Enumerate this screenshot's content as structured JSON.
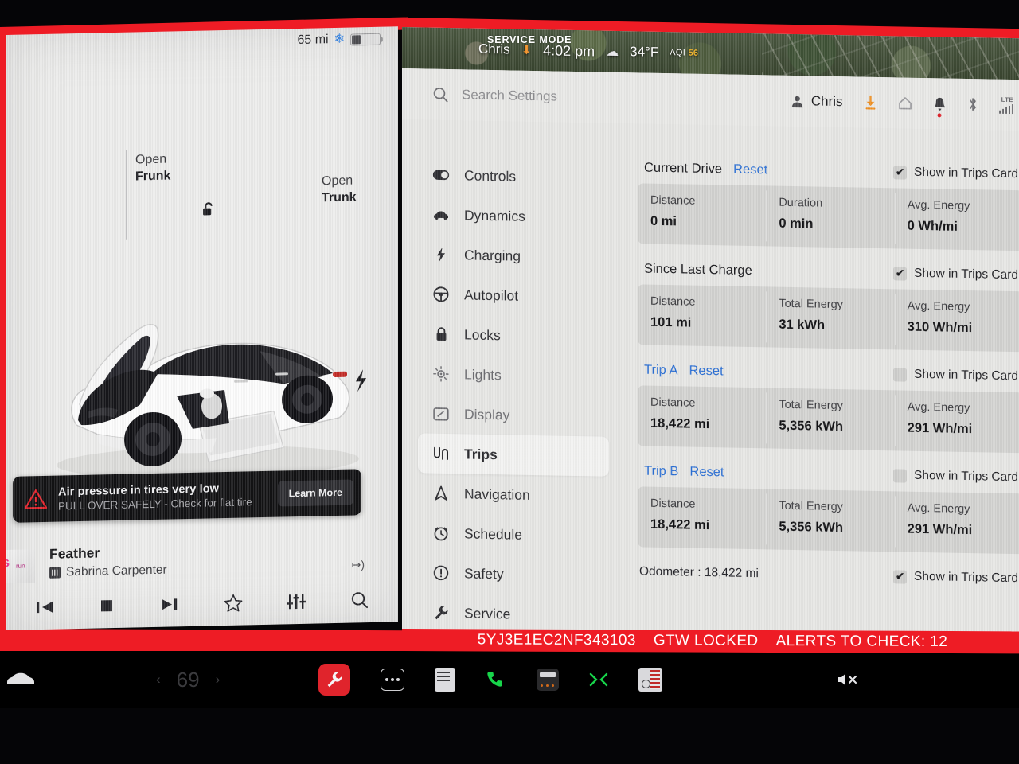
{
  "service_mode": {
    "label": "SERVICE MODE",
    "accent_color": "#ee1c25"
  },
  "bottom_status": {
    "vin": "5YJ3E1EC2NF343103",
    "gateway": "GTW LOCKED",
    "alerts": "ALERTS TO CHECK: 12"
  },
  "left_panel": {
    "range": "65 mi",
    "snowflake_icon": "snowflake-icon",
    "battery_icon": "battery-icon",
    "frunk": {
      "action": "Open",
      "target": "Frunk"
    },
    "trunk": {
      "action": "Open",
      "target": "Trunk"
    },
    "lock_icon": "unlocked-padlock-icon",
    "car_icon": "tesla-model-3-icon",
    "alert": {
      "icon": "warning-triangle-icon",
      "title": "Air pressure in tires very low",
      "subtitle": "PULL OVER SAFELY - Check for flat tire",
      "button": "Learn More"
    },
    "media": {
      "title": "Feather",
      "artist": "Sabrina Carpenter",
      "source_icon": "source-badge-icon",
      "hd_icon": "hd-audio-icon",
      "controls": [
        {
          "name": "previous-track-button",
          "glyph": "❘◀"
        },
        {
          "name": "stop-button",
          "glyph": "■"
        },
        {
          "name": "next-track-button",
          "glyph": "▶❘"
        },
        {
          "name": "favorite-button",
          "glyph": "☆"
        },
        {
          "name": "equalizer-button",
          "glyph": "⦀"
        },
        {
          "name": "media-search-button",
          "glyph": "⌕"
        }
      ]
    }
  },
  "map_bar": {
    "user": "Chris",
    "download_icon": "download-icon",
    "time": "4:02 pm",
    "weather_icon": "cloud-icon",
    "temperature": "34°F",
    "aqi_label": "AQI",
    "aqi_value": "56"
  },
  "settings_top": {
    "search_icon": "search-icon",
    "search_placeholder": "Search Settings",
    "search_value": "",
    "user": "Chris",
    "user_icon": "person-icon",
    "icons": [
      {
        "name": "download-icon",
        "glyph": "⬇"
      },
      {
        "name": "home-icon",
        "glyph": "⌂"
      },
      {
        "name": "bell-icon",
        "glyph": "🔔"
      },
      {
        "name": "bluetooth-icon",
        "glyph": "ᛗ"
      }
    ],
    "network_label": "LTE"
  },
  "sidebar": {
    "items": [
      {
        "label": "Controls",
        "icon": "toggle-icon",
        "selected": false,
        "faded": false
      },
      {
        "label": "Dynamics",
        "icon": "car-icon",
        "selected": false,
        "faded": false
      },
      {
        "label": "Charging",
        "icon": "lightning-bolt-icon",
        "selected": false,
        "faded": false
      },
      {
        "label": "Autopilot",
        "icon": "steering-wheel-icon",
        "selected": false,
        "faded": false
      },
      {
        "label": "Locks",
        "icon": "lock-icon",
        "selected": false,
        "faded": false
      },
      {
        "label": "Lights",
        "icon": "sun-icon",
        "selected": false,
        "faded": true
      },
      {
        "label": "Display",
        "icon": "display-icon",
        "selected": false,
        "faded": true
      },
      {
        "label": "Trips",
        "icon": "trips-icon",
        "selected": true,
        "faded": false
      },
      {
        "label": "Navigation",
        "icon": "navigation-icon",
        "selected": false,
        "faded": false
      },
      {
        "label": "Schedule",
        "icon": "clock-icon",
        "selected": false,
        "faded": false
      },
      {
        "label": "Safety",
        "icon": "exclamation-circle-icon",
        "selected": false,
        "faded": false
      },
      {
        "label": "Service",
        "icon": "wrench-icon",
        "selected": false,
        "faded": false
      }
    ]
  },
  "trips": {
    "show_in_trips_card_label": "Show in Trips Card",
    "reset_label": "Reset",
    "checkmark": "✔",
    "sections": [
      {
        "title": "Current Drive",
        "has_reset": true,
        "title_is_link": false,
        "show_in_card": true,
        "cells": [
          {
            "label": "Distance",
            "value": "0 mi"
          },
          {
            "label": "Duration",
            "value": "0 min"
          },
          {
            "label": "Avg. Energy",
            "value": "0 Wh/mi"
          }
        ]
      },
      {
        "title": "Since Last Charge",
        "has_reset": false,
        "title_is_link": false,
        "show_in_card": true,
        "cells": [
          {
            "label": "Distance",
            "value": "101 mi"
          },
          {
            "label": "Total Energy",
            "value": "31 kWh"
          },
          {
            "label": "Avg. Energy",
            "value": "310 Wh/mi"
          }
        ]
      },
      {
        "title": "Trip A",
        "has_reset": true,
        "title_is_link": true,
        "show_in_card": false,
        "cells": [
          {
            "label": "Distance",
            "value": "18,422 mi"
          },
          {
            "label": "Total Energy",
            "value": "5,356 kWh"
          },
          {
            "label": "Avg. Energy",
            "value": "291 Wh/mi"
          }
        ]
      },
      {
        "title": "Trip B",
        "has_reset": true,
        "title_is_link": true,
        "show_in_card": false,
        "cells": [
          {
            "label": "Distance",
            "value": "18,422 mi"
          },
          {
            "label": "Total Energy",
            "value": "5,356 kWh"
          },
          {
            "label": "Avg. Energy",
            "value": "291 Wh/mi"
          }
        ]
      }
    ],
    "odometer": {
      "text": "Odometer :  18,422 mi",
      "show_in_card": true
    }
  },
  "taskbar": {
    "car_icon": "car-icon",
    "climate": {
      "prev": "‹",
      "temperature": "69",
      "next": "›"
    },
    "buttons": [
      {
        "name": "service-button",
        "label": "wrench-icon"
      },
      {
        "name": "more-button",
        "label": "more-dots-icon"
      },
      {
        "name": "glovebox-button",
        "label": "glovebox-icon"
      },
      {
        "name": "phone-button",
        "label": "phone-icon"
      },
      {
        "name": "keypad-button",
        "label": "keypad-icon"
      },
      {
        "name": "shuffle-button",
        "label": "shuffle-icon"
      },
      {
        "name": "radio-button",
        "label": "radio-icon"
      },
      {
        "name": "mute-button",
        "label": "mute-icon"
      }
    ]
  }
}
